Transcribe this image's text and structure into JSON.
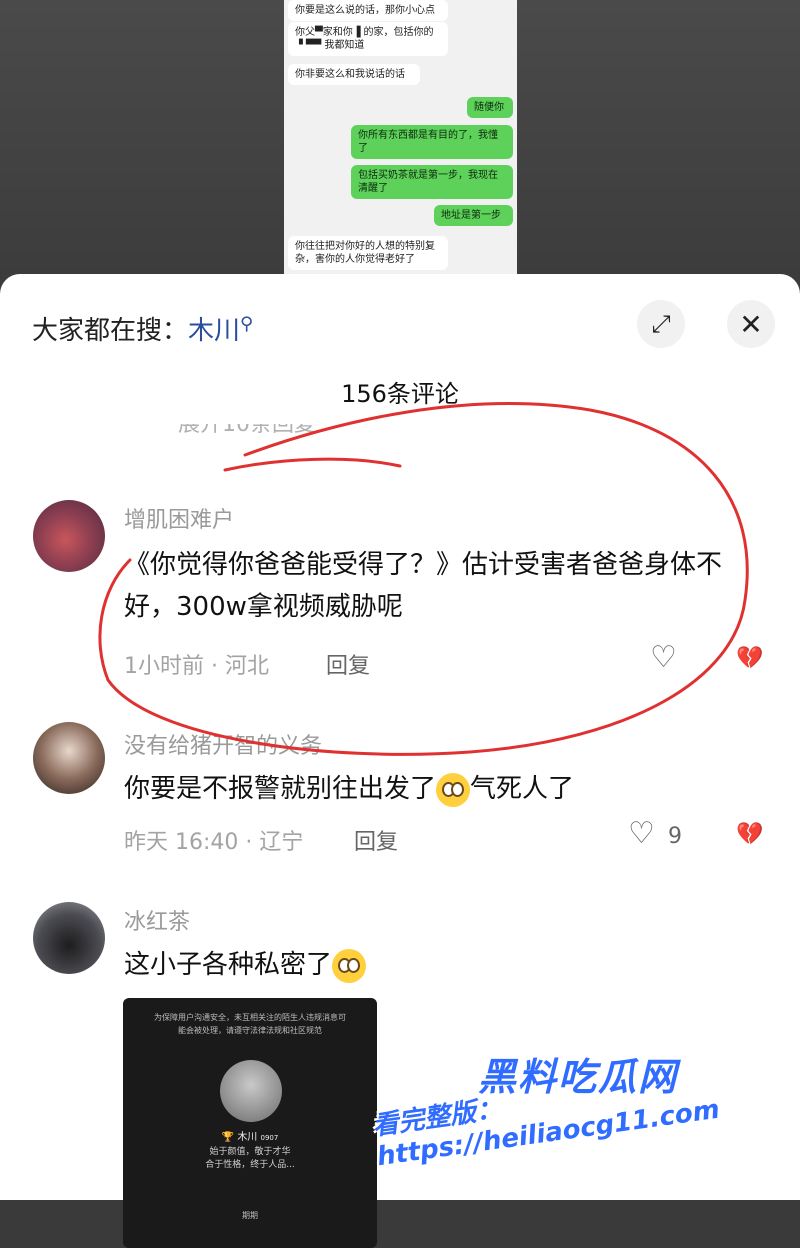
{
  "chat_screenshot": {
    "messages": [
      {
        "side": "left",
        "text": "你要是这么说的话，那你小心点"
      },
      {
        "side": "left",
        "text": "你父▀家和你▐ 的家，包括你的▝ ▀▀ 我都知道"
      },
      {
        "side": "left",
        "text": "你非要这么和我说话的话"
      },
      {
        "side": "right",
        "text": "随便你"
      },
      {
        "side": "right",
        "text": "你所有东西都是有目的了，我懂了"
      },
      {
        "side": "right",
        "text": "包括买奶茶就是第一步，我现在清醒了"
      },
      {
        "side": "right",
        "text": "地址是第一步"
      },
      {
        "side": "left",
        "text": "你往往把对你好的人想的特别复杂，害你的人你觉得老好了"
      }
    ]
  },
  "header": {
    "search_prefix": "大家都在搜：",
    "search_keyword": "木川"
  },
  "comment_count": "156条评论",
  "partial_text": "展开10条回复",
  "comments": [
    {
      "username": "增肌困难户",
      "text": "《你觉得你爸爸能受得了？》估计受害者爸爸身体不好，300w拿视频威胁呢",
      "meta": "1小时前 · 河北",
      "reply": "回复",
      "likes": ""
    },
    {
      "username": "没有给猪开智的义务",
      "text_before": "你要是不报警就别往出发了",
      "text_after": "气死人了",
      "meta": "昨天 16:40 · 辽宁",
      "reply": "回复",
      "likes": "9"
    },
    {
      "username": "冰红茶",
      "text_before": "这小子各种私密了",
      "meta": "",
      "reply": "",
      "likes": ""
    }
  ],
  "media_card": {
    "notice_line1": "为保障用户沟通安全，未互相关注的陌生人违规消息可",
    "notice_line2": "能会被处理，请遵守法律法规和社区规范",
    "name": "木川",
    "name_suffix": "0907",
    "bio_line1": "始于颜值，敬于才华",
    "bio_line2": "合于性格，终于人品...",
    "footer": "期期"
  },
  "watermark": {
    "brand": "黑料吃瓜网",
    "url_line": "看完整版：https://heiliaocg11.com"
  },
  "colors": {
    "accent": "#2b4d9c",
    "annotation_red": "#e03131",
    "bubble_green": "#5dd15a",
    "watermark_blue": "#2f6cff"
  }
}
